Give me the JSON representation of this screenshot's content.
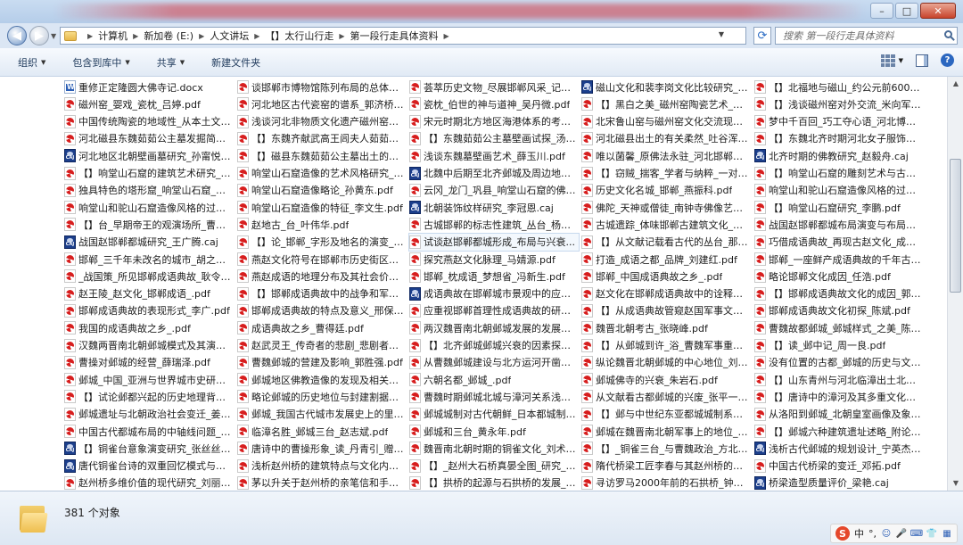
{
  "address": {
    "crumbs": [
      "计算机",
      "新加卷 (E:)",
      "人文讲坛",
      "【】太行山行走",
      "第一段行走具体资料"
    ]
  },
  "search": {
    "placeholder": "搜索 第一段行走具体资料"
  },
  "toolbar": {
    "organize": "组织",
    "include_in_library": "包含到库中",
    "share": "共享",
    "new_folder": "新建文件夹"
  },
  "status": {
    "count_text": "381 个对象"
  },
  "tray": {
    "ime_label": "中",
    "dot": "°,"
  },
  "columns": [
    [
      {
        "name": "重修正定隆圆大佛寺记.docx",
        "type": "docx"
      },
      {
        "name": "磁州窑_婴戏_瓷枕_吕婷.pdf",
        "type": "pdf"
      },
      {
        "name": "中国传统陶瓷的地域性_从本土文化...",
        "type": "pdf"
      },
      {
        "name": "河北磁县东魏茹茹公主墓发掘简报_...",
        "type": "pdf"
      },
      {
        "name": "河北地区北朝壁画墓研究_孙甯悦.caj",
        "type": "caj"
      },
      {
        "name": "【】响堂山石窟的建筑艺术研究_邢...",
        "type": "pdf"
      },
      {
        "name": "独具特色的塔形窟_响堂山石窟_唐仲...",
        "type": "pdf"
      },
      {
        "name": "响堂山和驼山石窟造像风格的过渡特征...",
        "type": "pdf"
      },
      {
        "name": "【】台_早期帝王的观演场所_曹飞.pdf",
        "type": "pdf"
      },
      {
        "name": "战国赵邯郸都城研究_王广腾.caj",
        "type": "caj"
      },
      {
        "name": "邯郸_三千年未改名的城市_胡之役.pdf",
        "type": "pdf"
      },
      {
        "name": "_战国策_所见邯郸成语典故_耿令为...",
        "type": "pdf"
      },
      {
        "name": "赵王陵_赵文化_邯郸成语_.pdf",
        "type": "pdf"
      },
      {
        "name": "邯郸成语典故的表现形式_李广.pdf",
        "type": "pdf"
      },
      {
        "name": "我国的成语典故之乡_.pdf",
        "type": "pdf"
      },
      {
        "name": "汉魏两晋南北朝邺城模式及其演变_...",
        "type": "pdf"
      },
      {
        "name": "曹操对邺城的经营_薛瑞泽.pdf",
        "type": "pdf"
      },
      {
        "name": "邺城_中国_亚洲与世界城市史研究中...",
        "type": "pdf"
      },
      {
        "name": "【】试论邺都兴起的历史地理背景及...",
        "type": "pdf"
      },
      {
        "name": "邺城遗址与北朝政治社会变迁_姜望...",
        "type": "pdf"
      },
      {
        "name": "中国古代都城布局的中轴线问题_李...",
        "type": "pdf"
      },
      {
        "name": "【】铜雀台意象演变研究_张丝丝.caj",
        "type": "caj"
      },
      {
        "name": "唐代铜雀台诗的双重回忆模式与宫怨...",
        "type": "caj"
      },
      {
        "name": "赵州桥多维价值的现代研究_刘丽.pdf",
        "type": "pdf"
      }
    ],
    [
      {
        "name": "谈邯郸市博物馆陈列布局的总体设计...",
        "type": "pdf"
      },
      {
        "name": "河北地区古代瓷窑的谱系_郭济桥.pdf",
        "type": "pdf"
      },
      {
        "name": "浅谈河北非物质文化遗产磁州窑陶瓷...",
        "type": "pdf"
      },
      {
        "name": "【】东魏齐献武高王闾夫人茹茹公主...",
        "type": "pdf"
      },
      {
        "name": "【】磁县东魏茹茹公主墓出土的拜占...",
        "type": "pdf"
      },
      {
        "name": "响堂山石窟造像的艺术风格研究_李...",
        "type": "pdf"
      },
      {
        "name": "响堂山石窟造像略论_孙黄东.pdf",
        "type": "pdf"
      },
      {
        "name": "响堂山石窟造像的特征_李文生.pdf",
        "type": "pdf"
      },
      {
        "name": "赵地古_台_叶伟华.pdf",
        "type": "pdf"
      },
      {
        "name": "【】论_邯郸_字形及地名的演变_杜...",
        "type": "pdf"
      },
      {
        "name": "燕赵文化符号在邯郸市历史街区改造...",
        "type": "pdf"
      },
      {
        "name": "燕赵成语的地理分布及其社会价值的...",
        "type": "pdf"
      },
      {
        "name": "【】邯郸成语典故中的战争和军事史...",
        "type": "pdf"
      },
      {
        "name": "邯郸成语典故的特点及意义_邢保良...",
        "type": "pdf"
      },
      {
        "name": "成语典故之乡_曹得廷.pdf",
        "type": "pdf"
      },
      {
        "name": "赵武灵王_传奇者的悲剧_悲剧者的传...",
        "type": "pdf"
      },
      {
        "name": "曹魏邺城的营建及影响_郭胜强.pdf",
        "type": "pdf"
      },
      {
        "name": "邺城地区佛教造像的发现及相关问题...",
        "type": "pdf"
      },
      {
        "name": "略论邺城的历史地位与封建割据的关...",
        "type": "pdf"
      },
      {
        "name": "邺城_我国古代城市发展史上的里程...",
        "type": "pdf"
      },
      {
        "name": "临漳名胜_邺城三台_赵志斌.pdf",
        "type": "pdf"
      },
      {
        "name": "唐诗中的曹操形象_读_丹青引_赠曹...",
        "type": "pdf"
      },
      {
        "name": "浅析赵州桥的建筑特点与文化内涵_...",
        "type": "pdf"
      },
      {
        "name": "茅以升关于赵州桥的亲笔信和手稿_...",
        "type": "pdf"
      }
    ],
    [
      {
        "name": "荟萃历史文物_尽展邯郸风采_记邯郸...",
        "type": "pdf"
      },
      {
        "name": "瓷枕_伯世的神与道神_吴丹微.pdf",
        "type": "pdf"
      },
      {
        "name": "宋元时期北方地区海港体系的考古学...",
        "type": "pdf"
      },
      {
        "name": "【】东魏茹茹公主墓壁画试探_汤池...",
        "type": "pdf"
      },
      {
        "name": "浅谈东魏墓壁画艺术_薛玉川.pdf",
        "type": "pdf"
      },
      {
        "name": "北魏中后期至北齐邺城及周边地区造...",
        "type": "caj"
      },
      {
        "name": "云冈_龙门_巩县_响堂山石窟的佛衣...",
        "type": "pdf"
      },
      {
        "name": "北朝装饰纹样研究_李冠恩.caj",
        "type": "caj"
      },
      {
        "name": "古城邯郸的标志性建筑_丛台_杨葳.pdf",
        "type": "pdf"
      },
      {
        "name": "试谈赵邯郸都城形成_布局与兴衰...",
        "type": "pdf",
        "sel": true
      },
      {
        "name": "探究燕赵文化脉理_马婧源.pdf",
        "type": "pdf"
      },
      {
        "name": "邯郸_枕成语_梦想省_冯新生.pdf",
        "type": "pdf"
      },
      {
        "name": "成语典故在邯郸城市景观中的应用研...",
        "type": "caj"
      },
      {
        "name": "应重视邯郸首理性成语典故的研究_...",
        "type": "pdf"
      },
      {
        "name": "两汉魏晋南北朝邺城发展的发展演变...",
        "type": "pdf"
      },
      {
        "name": "【】北齐邺城邺城兴衰的因素探析_...",
        "type": "pdf"
      },
      {
        "name": "从曹魏邺城建设与北方运河开凿看曹...",
        "type": "pdf"
      },
      {
        "name": "六朝名都_邺城_.pdf",
        "type": "pdf"
      },
      {
        "name": "曹魏时期邺城北城与漳河关系浅析_张...",
        "type": "pdf"
      },
      {
        "name": "邺城城制对古代朝鲜_日本都城制度...",
        "type": "pdf"
      },
      {
        "name": "邺城和三台_黄永年.pdf",
        "type": "pdf"
      },
      {
        "name": "魏晋南北朝时期的铜雀文化_刘术.pdf",
        "type": "pdf"
      },
      {
        "name": "【】_赵州大石桥真晏全图_研究_王...",
        "type": "pdf"
      },
      {
        "name": "【】拱桥的起源与石拱桥的发展_徐...",
        "type": "pdf"
      }
    ],
    [
      {
        "name": "磁山文化和裴李岗文化比较研究_韩...",
        "type": "caj"
      },
      {
        "name": "【】黑白之美_磁州窑陶瓷艺术_党永...",
        "type": "pdf"
      },
      {
        "name": "北宋鲁山窑与磁州窑文化交流现象之...",
        "type": "pdf"
      },
      {
        "name": "河北磁县出土的有关柔然_吐谷浑等...",
        "type": "pdf"
      },
      {
        "name": "唯以菌馨_原佛法永驻_河北邯郸北...",
        "type": "pdf"
      },
      {
        "name": "【】窃贼_揣客_学者与纳粹_一对明...",
        "type": "pdf"
      },
      {
        "name": "历史文化名城_邯郸_燕振科.pdf",
        "type": "pdf"
      },
      {
        "name": "佛陀_天神或僧徒_南钟寺佛像艺术学院所...",
        "type": "pdf"
      },
      {
        "name": "古城遗踪_体味邯郸古建筑文化_李爱...",
        "type": "pdf"
      },
      {
        "name": "【】从文献记载看古代的丛台_那良...",
        "type": "pdf"
      },
      {
        "name": "打造_成语之都_品牌_刘建红.pdf",
        "type": "pdf"
      },
      {
        "name": "邯郸_中国成语典故之乡_.pdf",
        "type": "pdf"
      },
      {
        "name": "赵文化在邯郸成语典故中的诠释研究...",
        "type": "pdf"
      },
      {
        "name": "【】从成语典故管窥赵国军事文化_...",
        "type": "pdf"
      },
      {
        "name": "魏晋北朝考古_张晓峰.pdf",
        "type": "pdf"
      },
      {
        "name": "【】从邺城到许_浴_曹魏军事重心区...",
        "type": "pdf"
      },
      {
        "name": "纵论魏晋北朝邺城的中心地位_刘志...",
        "type": "pdf"
      },
      {
        "name": "邺城佛寺的兴衰_朱岩石.pdf",
        "type": "pdf"
      },
      {
        "name": "从文献看古都邺城的兴废_张平一.pdf",
        "type": "pdf"
      },
      {
        "name": "【】邺与中世纪东亚都城城制系统_...",
        "type": "pdf"
      },
      {
        "name": "邺城在魏晋南北朝军事上的地位_杨...",
        "type": "pdf"
      },
      {
        "name": "【】_铜雀三台_与曹魏政治_方北辰...",
        "type": "pdf"
      },
      {
        "name": "隋代桥梁工匠李春与其赵州桥的历史...",
        "type": "pdf"
      },
      {
        "name": "寻访罗马2000年前的石拱桥_钟本俊...",
        "type": "pdf"
      }
    ],
    [
      {
        "name": "【】北福地与磁山_约公元前6000_...",
        "type": "pdf"
      },
      {
        "name": "【】浅谈磁州窑对外交流_米向军.pdf",
        "type": "pdf"
      },
      {
        "name": "梦中千百回_巧工夺心语_河北博物...",
        "type": "pdf"
      },
      {
        "name": "【】东魏北齐时期河北女子服饰探析_邢...",
        "type": "pdf"
      },
      {
        "name": "北齐时期的佛教研究_赵毅舟.caj",
        "type": "caj"
      },
      {
        "name": "【】响堂山石窟的雕刻艺术与古代磁州窑...",
        "type": "pdf"
      },
      {
        "name": "响堂山和驼山石窟造像风格的过渡特...",
        "type": "pdf"
      },
      {
        "name": "【】响堂山石窟研究_李鹏.pdf",
        "type": "pdf"
      },
      {
        "name": "战国赵邯郸都城布局演变与布局研究...",
        "type": "pdf"
      },
      {
        "name": "巧借成语典故_再现古赵文化_成语...",
        "type": "pdf"
      },
      {
        "name": "邯郸_一座鲜产成语典故的千年古都_...",
        "type": "pdf"
      },
      {
        "name": "略论邯郸文化成因_任浩.pdf",
        "type": "pdf"
      },
      {
        "name": "【】邯郸成语典故文化的成因_郭秀...",
        "type": "pdf"
      },
      {
        "name": "邯郸成语典故文化初探_陈斌.pdf",
        "type": "pdf"
      },
      {
        "name": "曹魏故都邺城_邺城样式_之美_陈为.pdf",
        "type": "pdf"
      },
      {
        "name": "【】读_邺中记_周一良.pdf",
        "type": "pdf"
      },
      {
        "name": "没有位置的古都_邺城的历史与文化_...",
        "type": "pdf"
      },
      {
        "name": "【】山东青州与河北临漳出土北齐石...",
        "type": "pdf"
      },
      {
        "name": "【】唐诗中的漳河及其多重文化意蕴...",
        "type": "pdf"
      },
      {
        "name": "从洛阳到邺城_北朝皇室画像及象征...",
        "type": "pdf"
      },
      {
        "name": "【】邺城六种建筑遗址述略_附论曹操邺...",
        "type": "pdf"
      },
      {
        "name": "浅析古代邺城的规划设计_宁英杰.caj",
        "type": "caj"
      },
      {
        "name": "中国古代桥梁的变迁_邓拓.pdf",
        "type": "pdf"
      },
      {
        "name": "桥梁造型质量评价_梁艳.caj",
        "type": "caj"
      }
    ]
  ]
}
